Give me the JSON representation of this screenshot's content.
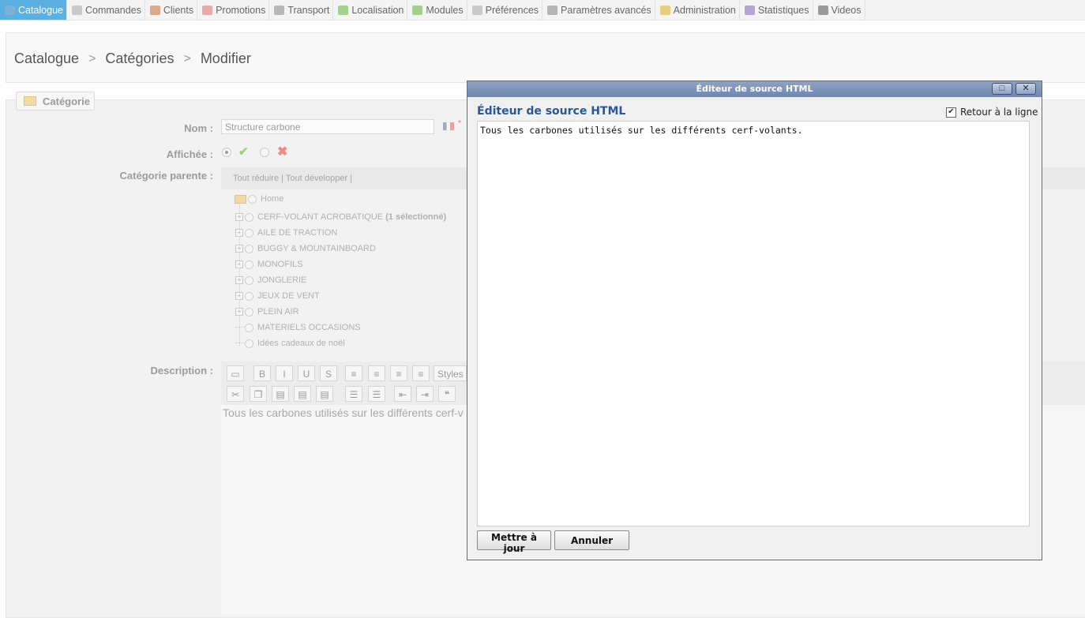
{
  "nav": [
    {
      "label": "Catalogue",
      "active": true,
      "icon": "catalog-icon",
      "color": "#7fb0d8"
    },
    {
      "label": "Commandes",
      "icon": "cart-icon",
      "color": "#c9c9c9"
    },
    {
      "label": "Clients",
      "icon": "user-icon",
      "color": "#d9a98a"
    },
    {
      "label": "Promotions",
      "icon": "tag-icon",
      "color": "#e7a9a9"
    },
    {
      "label": "Transport",
      "icon": "truck-icon",
      "color": "#b9b9b9"
    },
    {
      "label": "Localisation",
      "icon": "globe-icon",
      "color": "#a7d08e"
    },
    {
      "label": "Modules",
      "icon": "puzzle-icon",
      "color": "#a5cf8d"
    },
    {
      "label": "Préférences",
      "icon": "preferences-icon",
      "color": "#c9c9c9"
    },
    {
      "label": "Paramètres avancés",
      "icon": "wrench-icon",
      "color": "#b5b5b5"
    },
    {
      "label": "Administration",
      "icon": "key-icon",
      "color": "#e9cf7d"
    },
    {
      "label": "Statistiques",
      "icon": "chart-icon",
      "color": "#b3a6d6"
    },
    {
      "label": "Videos",
      "icon": "video-icon",
      "color": "#9a9a9a"
    }
  ],
  "breadcrumb": {
    "items": [
      "Catalogue",
      "Catégories",
      "Modifier"
    ],
    "sep": ">"
  },
  "form": {
    "legend": "Catégorie",
    "name_label": "Nom :",
    "name_value": "Structure carbone",
    "required_mark": "*",
    "displayed_label": "Affichée :",
    "check_glyph": "✔",
    "cross_glyph": "✖",
    "parent_label": "Catégorie parente :",
    "tree_actions": "Tout réduire |  Tout développer |",
    "tree": [
      {
        "label": "Home",
        "root": true
      },
      {
        "label": "CERF-VOLANT ACROBATIQUE",
        "extra": "(1 sélectionné)",
        "expandable": true
      },
      {
        "label": "AILE DE TRACTION",
        "expandable": true
      },
      {
        "label": "BUGGY & MOUNTAINBOARD",
        "expandable": true
      },
      {
        "label": "MONOFILS",
        "expandable": true
      },
      {
        "label": "JONGLERIE",
        "expandable": true
      },
      {
        "label": "JEUX DE VENT",
        "expandable": true
      },
      {
        "label": "PLEIN AIR",
        "expandable": true
      },
      {
        "label": "MATERIELS OCCASIONS",
        "expandable": false
      },
      {
        "label": "Idées cadeaux de noël",
        "expandable": false
      }
    ],
    "description_label": "Description :",
    "description_text": "Tous les carbones utilisés sur les différents cerf-v",
    "toolbar_styles": "Styles"
  },
  "dialog": {
    "title": "Éditeur de source HTML",
    "heading": "Éditeur de source HTML",
    "wrap_label": "Retour à la ligne",
    "source": "Tous les carbones utilisés sur les différents cerf-volants.",
    "update_label": "Mettre à jour",
    "cancel_label": "Annuler",
    "maximize_glyph": "□",
    "close_glyph": "✕"
  },
  "colors": {
    "accent": "#5ab0e2",
    "dialog_heading": "#2b5797",
    "titlebar": "#7f95ba"
  }
}
